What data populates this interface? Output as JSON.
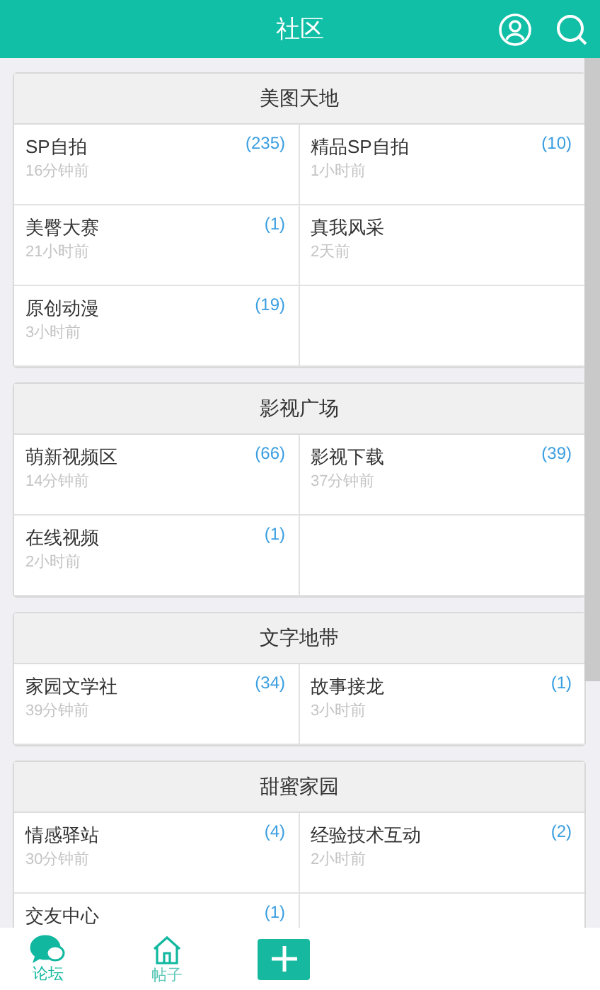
{
  "header": {
    "title": "社区"
  },
  "sections": [
    {
      "title": "美图天地",
      "forums": [
        {
          "name": "SP自拍",
          "count": "(235)",
          "time": "16分钟前"
        },
        {
          "name": "精品SP自拍",
          "count": "(10)",
          "time": "1小时前"
        },
        {
          "name": "美臀大赛",
          "count": "(1)",
          "time": "21小时前"
        },
        {
          "name": "真我风采",
          "time": "2天前"
        },
        {
          "name": "原创动漫",
          "count": "(19)",
          "time": "3小时前"
        }
      ]
    },
    {
      "title": "影视广场",
      "forums": [
        {
          "name": "萌新视频区",
          "count": "(66)",
          "time": "14分钟前"
        },
        {
          "name": "影视下载",
          "count": "(39)",
          "time": "37分钟前"
        },
        {
          "name": "在线视频",
          "count": "(1)",
          "time": "2小时前"
        }
      ]
    },
    {
      "title": "文字地带",
      "forums": [
        {
          "name": "家园文学社",
          "count": "(34)",
          "time": "39分钟前"
        },
        {
          "name": "故事接龙",
          "count": "(1)",
          "time": "3小时前"
        }
      ]
    },
    {
      "title": "甜蜜家园",
      "forums": [
        {
          "name": "情感驿站",
          "count": "(4)",
          "time": "30分钟前"
        },
        {
          "name": "经验技术互动",
          "count": "(2)",
          "time": "2小时前"
        },
        {
          "name": "交友中心",
          "count": "(1)"
        }
      ]
    }
  ],
  "tabbar": [
    {
      "kind": "forum",
      "label": "论坛",
      "selected": true
    },
    {
      "kind": "posts",
      "label": "帖子",
      "selected": false
    },
    {
      "kind": "add"
    }
  ]
}
